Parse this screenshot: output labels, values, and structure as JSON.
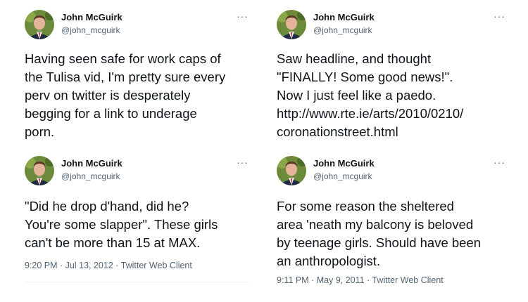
{
  "tweets": [
    {
      "author": "John McGuirk",
      "handle": "@john_mcguirk",
      "more": "···",
      "text": "Having seen safe for work caps of\nthe Tulisa vid, I'm pretty sure every\nperv on twitter is desperately\nbegging for a link to underage\nporn."
    },
    {
      "author": "John McGuirk",
      "handle": "@john_mcguirk",
      "more": "···",
      "text": "Saw headline, and thought\n\"FINALLY! Some good news!\".\nNow I just feel like a paedo.\nhttp://www.rte.ie/arts/2010/0210/\ncoronationstreet.html"
    },
    {
      "author": "John McGuirk",
      "handle": "@john_mcguirk",
      "more": "···",
      "text": "\"Did he drop d'hand, did he?\nYou're some slapper\". These girls\ncan't be more than 15 at MAX.",
      "meta": "9:20 PM · Jul 13, 2012 · Twitter Web Client"
    },
    {
      "author": "John McGuirk",
      "handle": "@john_mcguirk",
      "more": "···",
      "text": "For some reason the sheltered\narea 'neath my balcony is beloved\nby teenage girls. Should have been\nan anthropologist.",
      "meta": "9:11 PM · May 9, 2011 · Twitter Web Client"
    }
  ],
  "colors": {
    "text": "#0f1419",
    "secondary": "#536471",
    "divider": "#eff3f4"
  },
  "icons": {
    "avatar": "profile-photo",
    "more": "more-options-icon"
  }
}
